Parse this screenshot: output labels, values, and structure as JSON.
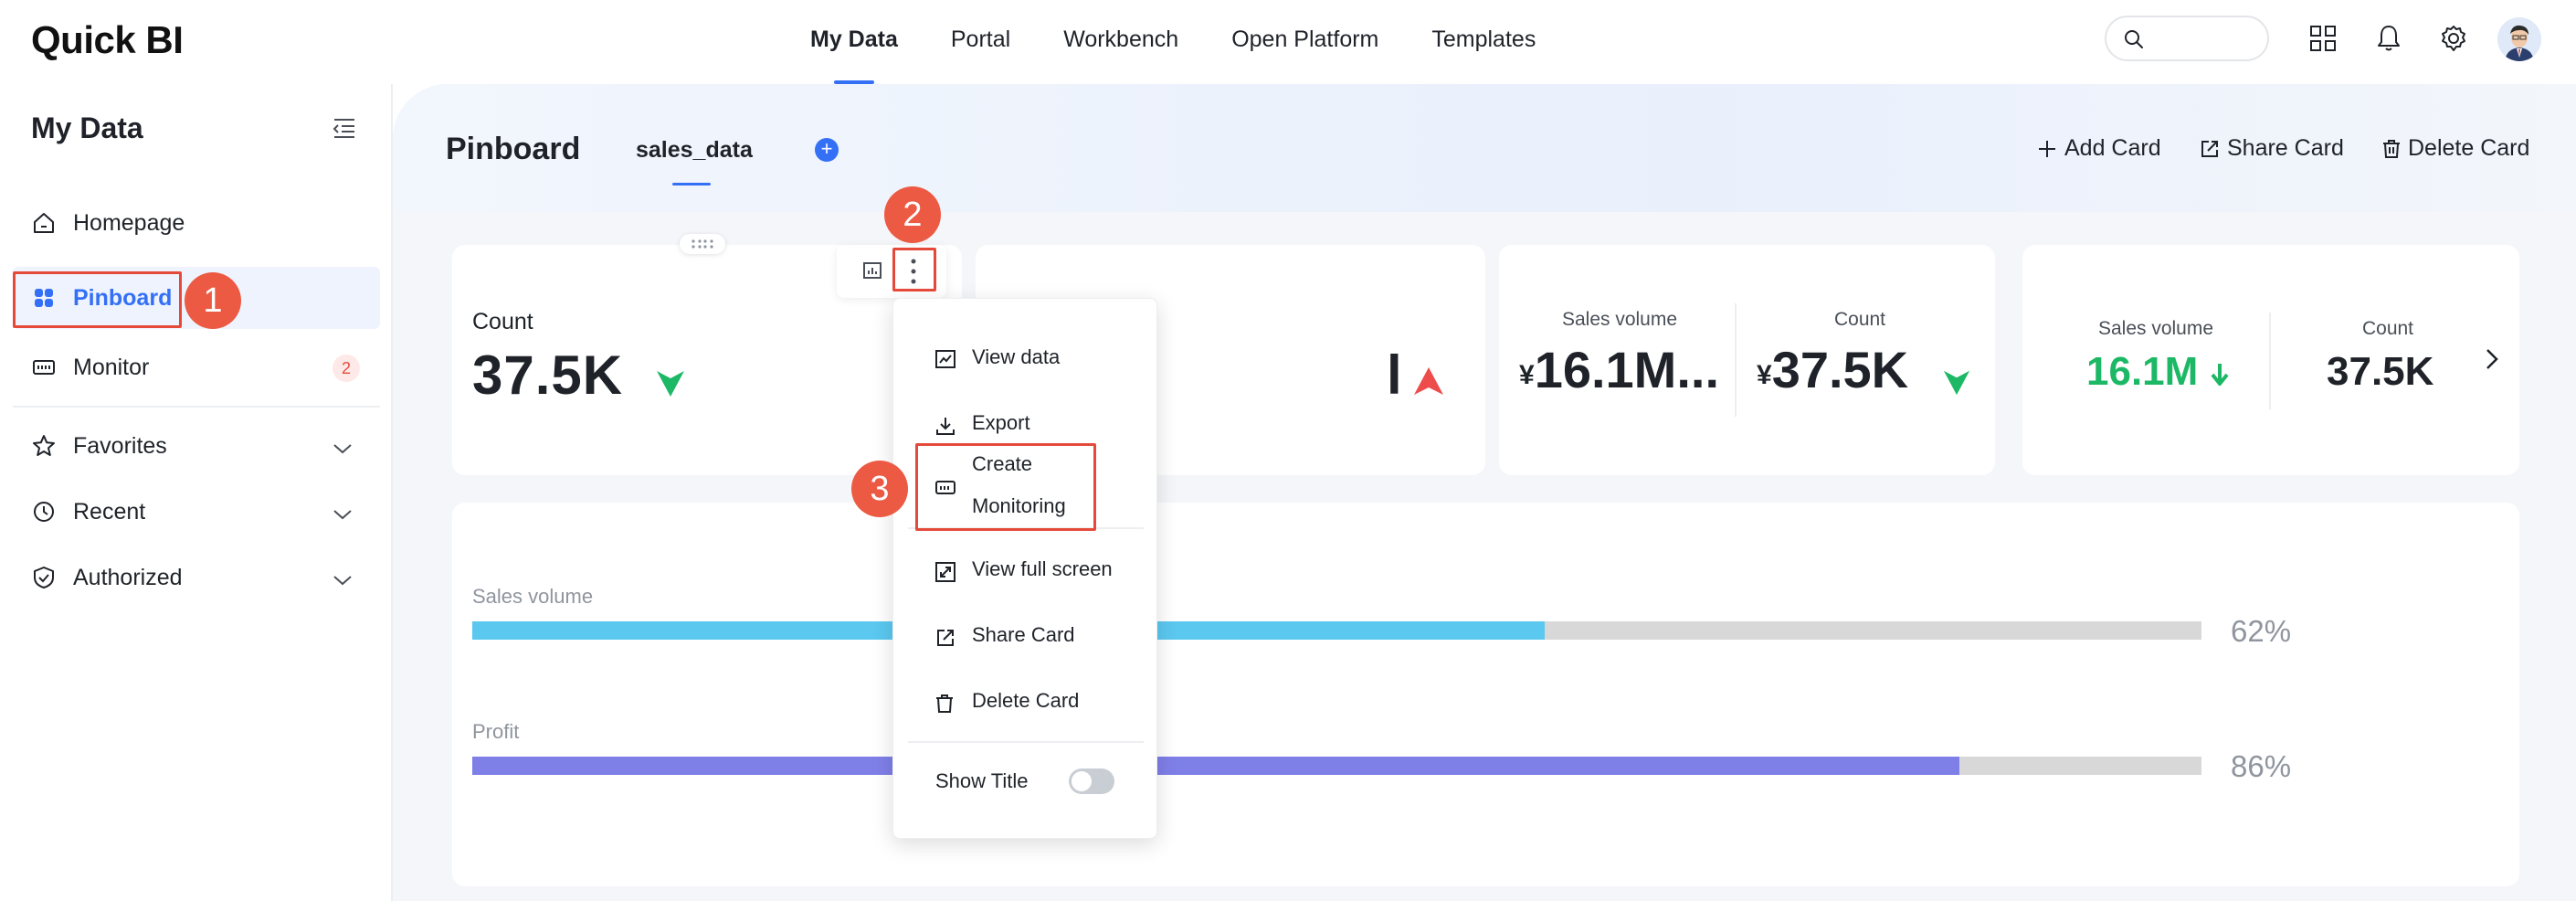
{
  "app": {
    "logo_text": "Quick BI"
  },
  "top_nav": {
    "items": [
      {
        "label": "My Data",
        "active": true
      },
      {
        "label": "Portal"
      },
      {
        "label": "Workbench"
      },
      {
        "label": "Open Platform"
      },
      {
        "label": "Templates"
      }
    ],
    "search_placeholder": "",
    "icons": [
      "apps-grid-icon",
      "bell-icon",
      "gear-icon",
      "avatar"
    ]
  },
  "sidebar": {
    "title": "My Data",
    "items": [
      {
        "label": "Homepage",
        "icon": "home-icon"
      },
      {
        "label": "Pinboard",
        "icon": "pinboard-icon",
        "active": true
      },
      {
        "label": "Monitor",
        "icon": "monitor-icon",
        "badge": "2"
      },
      {
        "label": "Favorites",
        "icon": "star-icon"
      },
      {
        "label": "Recent",
        "icon": "clock-icon"
      },
      {
        "label": "Authorized",
        "icon": "shield-icon"
      }
    ]
  },
  "main": {
    "title": "Pinboard",
    "tab": "sales_data",
    "actions": {
      "add": "Add Card",
      "share": "Share Card",
      "delete": "Delete Card"
    }
  },
  "cards": {
    "card1": {
      "label": "Count",
      "value": "37.5K",
      "trend": "up"
    },
    "card2": {
      "value_fragment": "l",
      "trend": "up"
    },
    "card3": {
      "left_label": "Sales volume",
      "left_prefix": "¥",
      "left_value": "16.1M...",
      "right_label": "Count",
      "right_prefix": "¥",
      "right_value": "37.5K",
      "trend": "up"
    },
    "card4": {
      "left_label": "Sales volume",
      "left_value": "16.1M",
      "left_trend": "down",
      "right_label": "Count",
      "right_value": "37.5K"
    }
  },
  "progress": {
    "items": [
      {
        "label": "Sales volume",
        "percent_text": "62%",
        "value": 0.62,
        "color": "#5bc8f0"
      },
      {
        "label": "Profit",
        "percent_text": "86%",
        "value": 0.86,
        "color": "#7f7fe8"
      }
    ]
  },
  "menu": {
    "view_data": "View data",
    "export": "Export",
    "create_monitoring_1": "Create",
    "create_monitoring_2": "Monitoring",
    "full_screen": "View full screen",
    "share_card": "Share Card",
    "delete_card": "Delete Card",
    "show_title": "Show Title",
    "show_title_on": false
  },
  "annotations": {
    "step1": "1",
    "step2": "2",
    "step3": "3"
  },
  "colors": {
    "accent": "#3470f6",
    "annotation": "#e5493a",
    "up_green": "#1db866",
    "up_red": "#ee4b4b"
  }
}
